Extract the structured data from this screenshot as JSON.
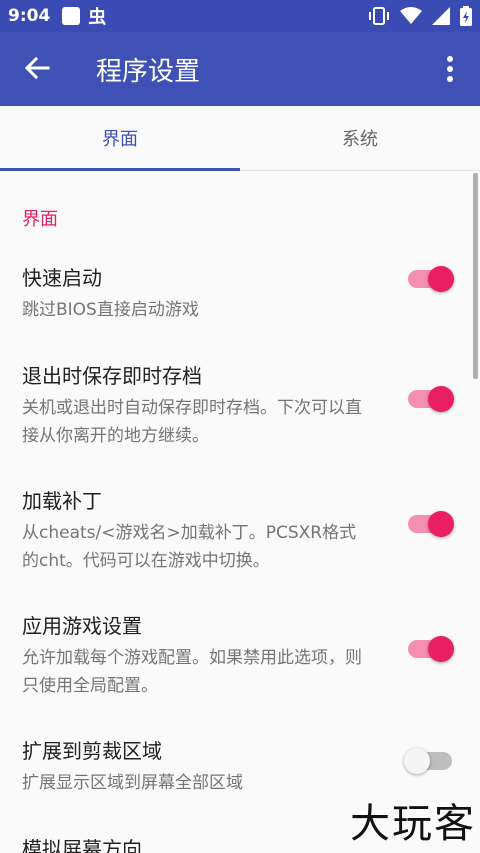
{
  "statusbar": {
    "time": "9:04",
    "bug_glyph": "虫"
  },
  "appbar": {
    "title": "程序设置"
  },
  "tabs": [
    {
      "label": "界面",
      "active": true
    },
    {
      "label": "系统",
      "active": false
    }
  ],
  "section": {
    "header": "界面"
  },
  "prefs": [
    {
      "title": "快速启动",
      "summary": "跳过BIOS直接启动游戏",
      "enabled": true
    },
    {
      "title": "退出时保存即时存档",
      "summary": "关机或退出时自动保存即时存档。下次可以直接从你离开的地方继续。",
      "enabled": true
    },
    {
      "title": "加载补丁",
      "summary": "从cheats/<游戏名>加载补丁。PCSXR格式的cht。代码可以在游戏中切换。",
      "enabled": true
    },
    {
      "title": "应用游戏设置",
      "summary": "允许加载每个游戏配置。如果禁用此选项，则只使用全局配置。",
      "enabled": true
    },
    {
      "title": "扩展到剪裁区域",
      "summary": "扩展显示区域到屏幕全部区域",
      "enabled": false
    },
    {
      "title": "模拟屏幕方向",
      "summary": "",
      "enabled": null
    }
  ],
  "watermark": "大玩客",
  "colors": {
    "primary": "#3f51b5",
    "statusbar": "#3a4bb3",
    "accent": "#e91e63"
  }
}
